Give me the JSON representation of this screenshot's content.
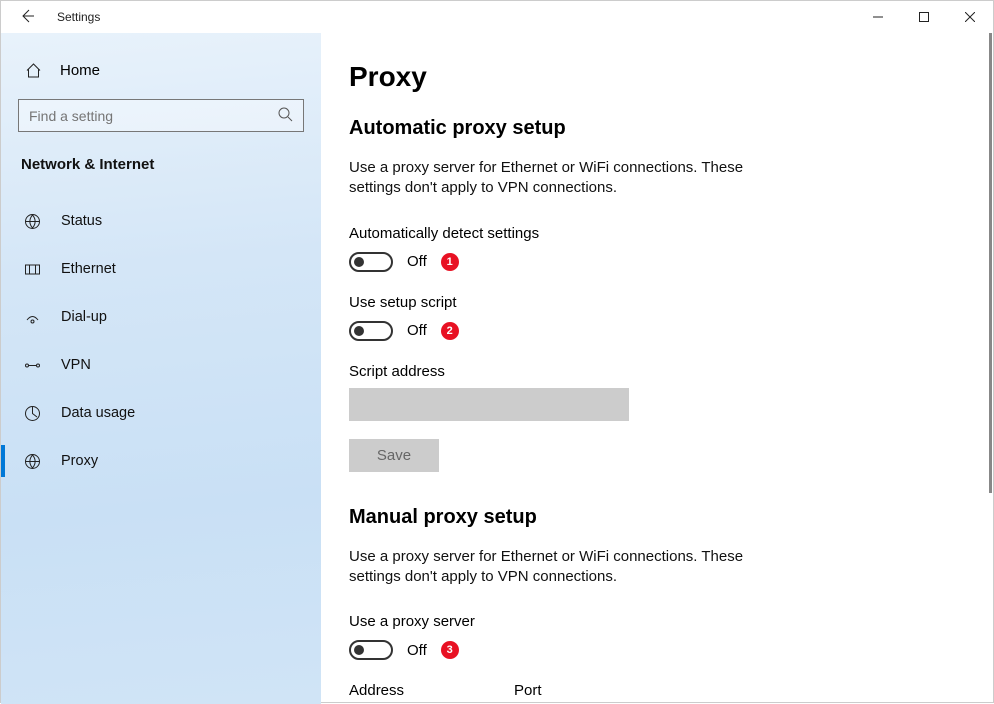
{
  "titlebar": {
    "title": "Settings"
  },
  "sidebar": {
    "home": "Home",
    "search_placeholder": "Find a setting",
    "heading": "Network & Internet",
    "items": [
      {
        "label": "Status"
      },
      {
        "label": "Ethernet"
      },
      {
        "label": "Dial-up"
      },
      {
        "label": "VPN"
      },
      {
        "label": "Data usage"
      },
      {
        "label": "Proxy"
      }
    ]
  },
  "page": {
    "title": "Proxy",
    "auto": {
      "heading": "Automatic proxy setup",
      "desc": "Use a proxy server for Ethernet or WiFi connections. These settings don't apply to VPN connections.",
      "detect_label": "Automatically detect settings",
      "detect_state": "Off",
      "detect_badge": "1",
      "script_label": "Use setup script",
      "script_state": "Off",
      "script_badge": "2",
      "script_addr_label": "Script address",
      "script_addr_value": "",
      "save_label": "Save"
    },
    "manual": {
      "heading": "Manual proxy setup",
      "desc": "Use a proxy server for Ethernet or WiFi connections. These settings don't apply to VPN connections.",
      "use_label": "Use a proxy server",
      "use_state": "Off",
      "use_badge": "3",
      "address_label": "Address",
      "port_label": "Port"
    }
  }
}
